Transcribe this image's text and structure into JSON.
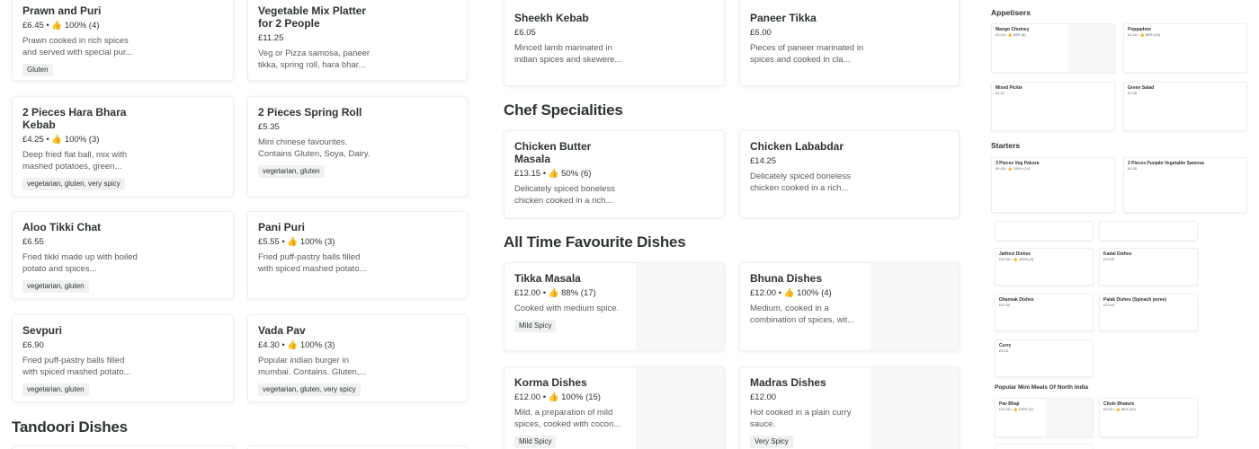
{
  "colors": {
    "text": "#2e3333",
    "muted": "#585c5c",
    "tag_bg": "#f0f2f2",
    "thumb_bg": "#f6f7f7"
  },
  "sections": {
    "tandoori": "Tandoori Dishes",
    "chef": "Chef Specialities",
    "favourite": "All Time Favourite Dishes"
  },
  "cards": [
    {
      "name": "Prawn and Puri",
      "meta": "£6.45 • 👍 100% (4)",
      "desc": "Prawn cooked in rich spices and served with special pur...",
      "tag": "Gluten"
    },
    {
      "name": "Vegetable Mix Platter for 2 People",
      "meta": "£11.25",
      "desc": "Veg or Pizza samosa, paneer tikka, spring roll, hara bhar...",
      "tag": ""
    },
    {
      "name": "2 Pieces Hara Bhara Kebab",
      "meta": "£4.25 • 👍 100% (3)",
      "desc": "Deep fried flat ball, mix with mashed potatoes, green...",
      "tag": "vegetarian, gluten, very spicy"
    },
    {
      "name": "2 Pieces Spring Roll",
      "meta": "£5.35",
      "desc": "Mini chinese favourites. Contains Gluten, Soya, Dairy.",
      "tag": "vegetarian, gluten"
    },
    {
      "name": "Aloo Tikki Chat",
      "meta": "£6.55",
      "desc": "Fried tikki made up with boiled potato and spices...",
      "tag": "vegetarian, gluten"
    },
    {
      "name": "Pani Puri",
      "meta": "£5.55 • 👍 100% (3)",
      "desc": "Fried puff-pastry balls filled with spiced mashed potato...",
      "tag": ""
    },
    {
      "name": "Sevpuri",
      "meta": "£6.90",
      "desc": "Fried puff-pastry balls filled with spiced mashed potato...",
      "tag": "vegetarian, gluten"
    },
    {
      "name": "Vada Pav",
      "meta": "£4.30 • 👍 100% (3)",
      "desc": "Popular indian burger in mumbai. Contains. Gluten,...",
      "tag": "vegetarian, gluten, very spicy"
    },
    {
      "name": "Sheekh Kebab",
      "meta": "£6.05",
      "desc": "Minced lamb marinated in indian spices and skewere...",
      "tag": ""
    },
    {
      "name": "Paneer Tikka",
      "meta": "£6.00",
      "desc": "Pieces of paneer marinated in spices and cooked in cla...",
      "tag": ""
    },
    {
      "name": "Chicken Butter Masala",
      "meta": "£13.15 • 👍 50% (6)",
      "desc": "Delicately spiced boneless chicken cooked in a rich...",
      "tag": ""
    },
    {
      "name": "Chicken Lababdar",
      "meta": "£14.25",
      "desc": "Delicately spiced boneless chicken cooked in a rich...",
      "tag": ""
    },
    {
      "name": "Tikka Masala",
      "meta": "£12.00 • 👍 88% (17)",
      "desc": "Cooked with medium spice.",
      "tag": "Mild Spicy"
    },
    {
      "name": "Bhuna Dishes",
      "meta": "£12.00 • 👍 100% (4)",
      "desc": "Medium, cooked in a combination of spices, wit...",
      "tag": ""
    },
    {
      "name": "Korma Dishes",
      "meta": "£12.00 • 👍 100% (15)",
      "desc": "Mild, a preparation of mild spices, cooked with cocon...",
      "tag": "Mild Spicy"
    },
    {
      "name": "Madras Dishes",
      "meta": "£12.00",
      "desc": "Hot cooked in a plain curry sauce.",
      "tag": "Very Spicy"
    }
  ],
  "mini": {
    "headings": [
      "Appetisers",
      "Starters",
      "Popular Mini Meals Of North India"
    ],
    "cards": [
      {
        "name": "Mango Chutney",
        "meta": "£1.10 • 👍 83% (6)"
      },
      {
        "name": "Poppadom",
        "meta": "£1.10 • 👍 89% (19)"
      },
      {
        "name": "Mixed Pickle",
        "meta": "£1.10"
      },
      {
        "name": "Green Salad",
        "meta": "£2.45"
      },
      {
        "name": "3 Pieces Veg Pakora",
        "meta": "£4.45 • 👍 100% (14)"
      },
      {
        "name": "2 Pieces Punjabi Vegetable Samosa",
        "meta": "£4.45"
      },
      {
        "name": "Jalfrezi Dishes",
        "meta": "£12.00 • 👍 100% (4)"
      },
      {
        "name": "Kadai Dishes",
        "meta": "£12.00"
      },
      {
        "name": "Dhansak Dishes",
        "meta": "£12.00"
      },
      {
        "name": "Palak Dishes (Spinach puree)",
        "meta": "£12.00"
      },
      {
        "name": "Curry",
        "meta": "£9.15"
      },
      {
        "name": "Pav Bhaji",
        "meta": "£11.00 • 👍 100% (2)"
      },
      {
        "name": "Chole Bhature",
        "meta": "£9.00 • 👍 80% (10)"
      }
    ]
  }
}
